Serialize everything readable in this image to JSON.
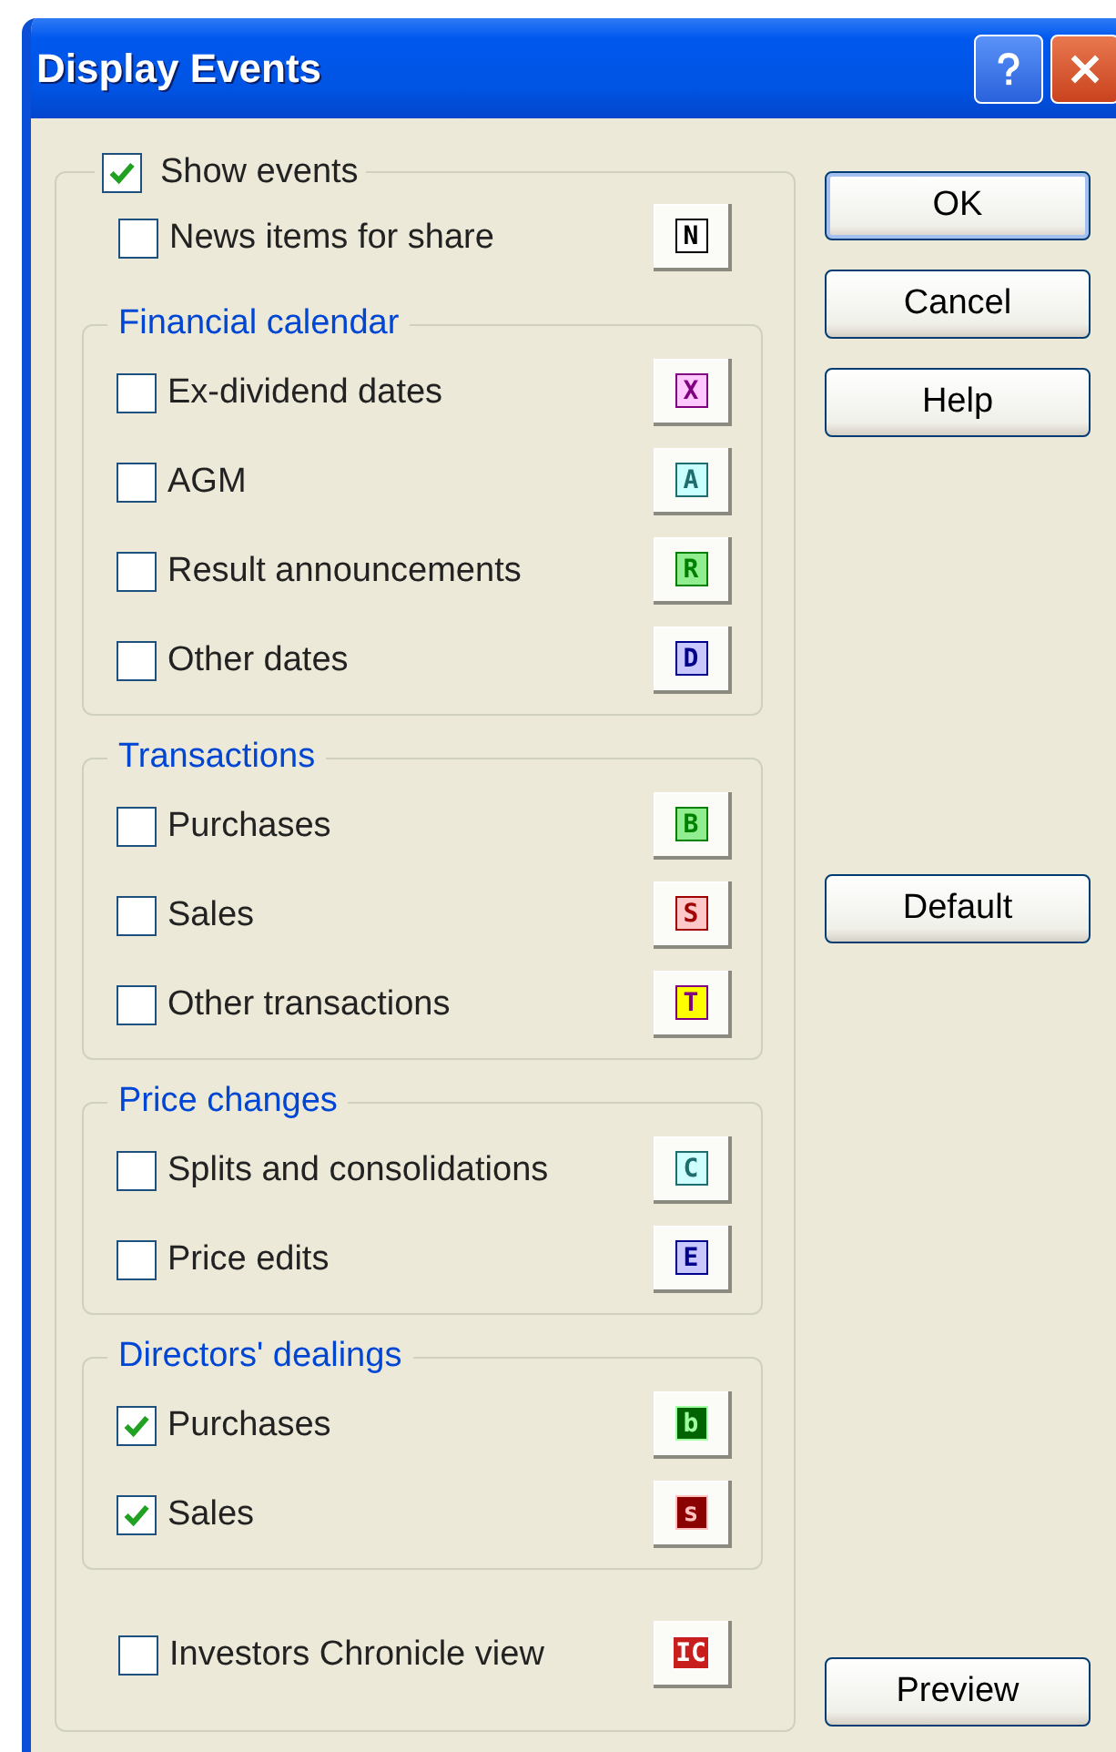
{
  "window": {
    "title": "Display Events"
  },
  "show_events": {
    "label": "Show events",
    "checked": true
  },
  "news": {
    "label": "News items for share",
    "checked": false,
    "marker": {
      "letter": "N",
      "color": "#000000",
      "fill": {
        "color": "#ffffff"
      }
    }
  },
  "groups": [
    {
      "title": "Financial calendar",
      "items": [
        {
          "label": "Ex-dividend dates",
          "checked": false,
          "marker": {
            "letter": "X",
            "color": "#800080",
            "fill": {
              "color": "#ffc8ff"
            }
          }
        },
        {
          "label": "AGM",
          "checked": false,
          "marker": {
            "letter": "A",
            "color": "#1e6e6e",
            "fill": {
              "color": "#c8ffff"
            }
          }
        },
        {
          "label": "Result announcements",
          "checked": false,
          "marker": {
            "letter": "R",
            "color": "#008000",
            "fill": {
              "color": "#90ee90"
            }
          }
        },
        {
          "label": "Other dates",
          "checked": false,
          "marker": {
            "letter": "D",
            "color": "#00008b",
            "fill": {
              "color": "#c8c8ff"
            }
          }
        }
      ]
    },
    {
      "title": "Transactions",
      "items": [
        {
          "label": "Purchases",
          "checked": false,
          "marker": {
            "letter": "B",
            "color": "#008000",
            "fill": {
              "color": "#90ee90"
            }
          }
        },
        {
          "label": "Sales",
          "checked": false,
          "marker": {
            "letter": "S",
            "color": "#a00000",
            "fill": {
              "color": "#ffc8c8"
            }
          }
        },
        {
          "label": "Other transactions",
          "checked": false,
          "marker": {
            "letter": "T",
            "color": "#800080",
            "fill": {
              "color": "#ffff00"
            }
          }
        }
      ]
    },
    {
      "title": "Price changes",
      "items": [
        {
          "label": "Splits and consolidations",
          "checked": false,
          "marker": {
            "letter": "C",
            "color": "#1e6e6e",
            "fill": {
              "color": "#d0ffff"
            }
          }
        },
        {
          "label": "Price edits",
          "checked": false,
          "marker": {
            "letter": "E",
            "color": "#00008b",
            "fill": {
              "color": "#c8c8ff"
            }
          }
        }
      ]
    },
    {
      "title": "Directors' dealings",
      "items": [
        {
          "label": "Purchases",
          "checked": true,
          "marker": {
            "letter": "b",
            "color": "#a0ffa0",
            "fill": {
              "color": "#006400"
            }
          }
        },
        {
          "label": "Sales",
          "checked": true,
          "marker": {
            "letter": "s",
            "color": "#ffc0c0",
            "fill": {
              "color": "#8b0000"
            }
          }
        }
      ]
    }
  ],
  "chronicle": {
    "label": "Investors Chronicle view",
    "checked": false,
    "marker": {
      "letter": "IC",
      "color": "#ffffff",
      "fill": {
        "color": "#c81e1e"
      }
    }
  },
  "buttons": [
    {
      "label": "OK",
      "default": true,
      "kind": "top"
    },
    {
      "label": "Cancel",
      "default": false,
      "kind": "top"
    },
    {
      "label": "Help",
      "default": false,
      "kind": "top"
    },
    {
      "label": "Default",
      "default": false,
      "kind": "middle"
    },
    {
      "label": "Preview",
      "default": false,
      "kind": "bottom"
    }
  ]
}
